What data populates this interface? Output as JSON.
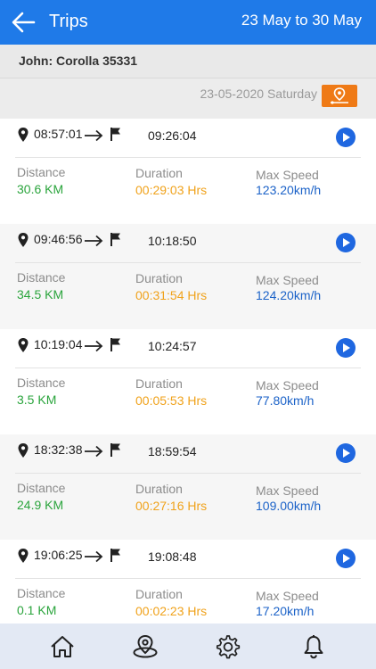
{
  "header": {
    "title": "Trips",
    "date_range": "23 May to 30 May"
  },
  "vehicle": "John: Corolla 35331",
  "date_label": "23-05-2020 Saturday",
  "labels": {
    "distance": "Distance",
    "duration": "Duration",
    "max_speed": "Max Speed"
  },
  "trips": [
    {
      "start": "08:57:01",
      "end": "09:26:04",
      "distance": "30.6 KM",
      "duration": "00:29:03 Hrs",
      "max_speed": "123.20km/h"
    },
    {
      "start": "09:46:56",
      "end": "10:18:50",
      "distance": "34.5 KM",
      "duration": "00:31:54 Hrs",
      "max_speed": "124.20km/h"
    },
    {
      "start": "10:19:04",
      "end": "10:24:57",
      "distance": "3.5 KM",
      "duration": "00:05:53 Hrs",
      "max_speed": "77.80km/h"
    },
    {
      "start": "18:32:38",
      "end": "18:59:54",
      "distance": "24.9 KM",
      "duration": "00:27:16 Hrs",
      "max_speed": "109.00km/h"
    },
    {
      "start": "19:06:25",
      "end": "19:08:48",
      "distance": "0.1 KM",
      "duration": "00:02:23 Hrs",
      "max_speed": "17.20km/h"
    }
  ],
  "icons": {
    "back": "arrow-left-icon",
    "map": "map-pin-route-icon",
    "start": "location-pin-icon",
    "to": "arrow-right-icon",
    "end": "flag-icon",
    "play": "play-icon",
    "tabs": [
      "home-icon",
      "location-radar-icon",
      "gear-icon",
      "bell-icon"
    ]
  },
  "colors": {
    "header": "#1f7ae8",
    "distance": "#2aa43c",
    "duration": "#f0a21b",
    "speed": "#1b62c8",
    "map_button": "#ef7a16",
    "play": "#1f67e0",
    "tab_bar": "#e3e9f4"
  }
}
